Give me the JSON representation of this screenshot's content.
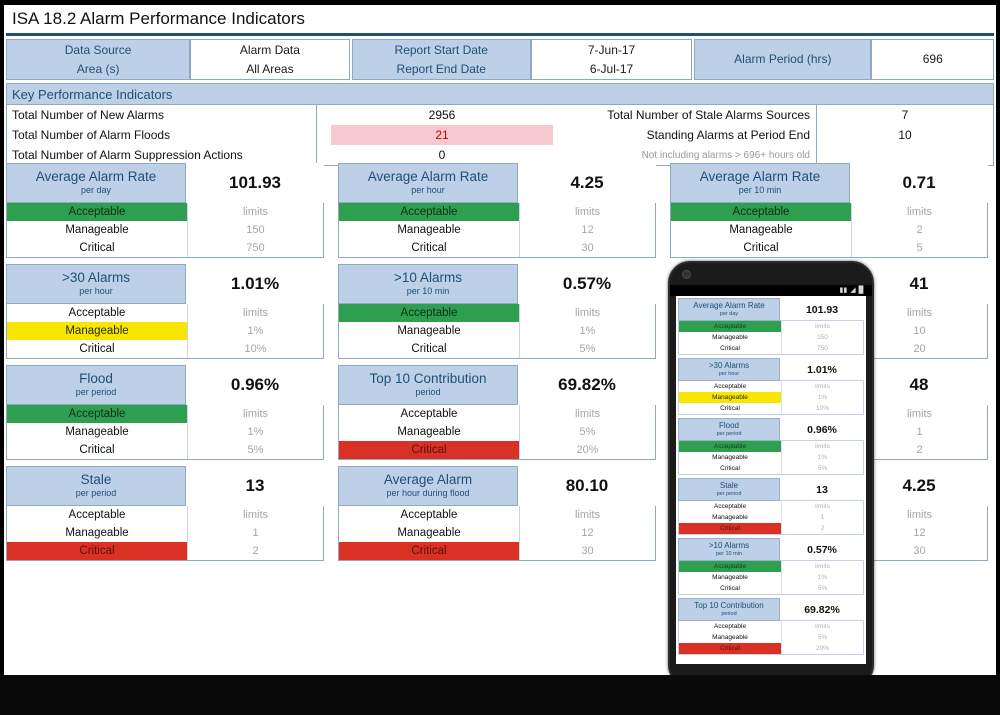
{
  "window": {
    "title": "ISA 18.2 Alarm Performance Indicators"
  },
  "source_bar": {
    "cells": [
      {
        "label_top": "Data Source",
        "label_bottom": "Area (s)",
        "value_top": "Alarm Data",
        "value_bottom": "All Areas"
      },
      {
        "label_top": "Report Start Date",
        "label_bottom": "Report End Date",
        "value_top": "7-Jun-17",
        "value_bottom": "6-Jul-17"
      },
      {
        "label_top": "Alarm Period (hrs)",
        "label_bottom": "",
        "value_top": "696",
        "value_bottom": ""
      }
    ]
  },
  "kpi": {
    "band_title": "Key Performance Indicators",
    "left_rows": [
      "Total Number of New Alarms",
      "Total Number of Alarm Floods",
      "Total Number of Alarm Suppression Actions"
    ],
    "mid_values": [
      "2956",
      "21",
      "0"
    ],
    "right_rows": [
      "Total Number of Stale Alarms Sources",
      "Standing Alarms at Period End",
      "Not including alarms > 696+ hours old"
    ],
    "right_values": [
      "7",
      "10",
      ""
    ]
  },
  "cards": [
    [
      {
        "title": "Average Alarm Rate",
        "subtitle": "per day",
        "value": "101.93",
        "levels": [
          "Acceptable",
          "Manageable",
          "Critical"
        ],
        "limits": [
          "limits",
          "150",
          "750"
        ],
        "status": "green"
      },
      {
        "title": "Average Alarm Rate",
        "subtitle": "per hour",
        "value": "4.25",
        "levels": [
          "Acceptable",
          "Manageable",
          "Critical"
        ],
        "limits": [
          "limits",
          "12",
          "30"
        ],
        "status": "green"
      },
      {
        "title": "Average Alarm Rate",
        "subtitle": "per 10 min",
        "value": "0.71",
        "levels": [
          "Acceptable",
          "Manageable",
          "Critical"
        ],
        "limits": [
          "limits",
          "2",
          "5"
        ],
        "status": "green"
      }
    ],
    [
      {
        "title": ">30 Alarms",
        "subtitle": "per hour",
        "value": "1.01%",
        "levels": [
          "Acceptable",
          "Manageable",
          "Critical"
        ],
        "limits": [
          "limits",
          "1%",
          "10%"
        ],
        "status": "yellow"
      },
      {
        "title": ">10 Alarms",
        "subtitle": "per 10 min",
        "value": "0.57%",
        "levels": [
          "Acceptable",
          "Manageable",
          "Critical"
        ],
        "limits": [
          "limits",
          "1%",
          "5%"
        ],
        "status": "green"
      },
      {
        "title": "",
        "subtitle": "",
        "value": "41",
        "levels": [
          "",
          "",
          ""
        ],
        "limits": [
          "limits",
          "10",
          "20"
        ],
        "status": "none",
        "obscured": true
      }
    ],
    [
      {
        "title": "Flood",
        "subtitle": "per period",
        "value": "0.96%",
        "levels": [
          "Acceptable",
          "Manageable",
          "Critical"
        ],
        "limits": [
          "limits",
          "1%",
          "5%"
        ],
        "status": "green"
      },
      {
        "title": "Top 10 Contribution",
        "subtitle": "period",
        "value": "69.82%",
        "levels": [
          "Acceptable",
          "Manageable",
          "Critical"
        ],
        "limits": [
          "limits",
          "5%",
          "20%"
        ],
        "status": "red"
      },
      {
        "title": "",
        "subtitle": "",
        "value": "48",
        "levels": [
          "",
          "",
          ""
        ],
        "limits": [
          "limits",
          "1",
          "2"
        ],
        "status": "none",
        "obscured": true
      }
    ],
    [
      {
        "title": "Stale",
        "subtitle": "per period",
        "value": "13",
        "levels": [
          "Acceptable",
          "Manageable",
          "Critical"
        ],
        "limits": [
          "limits",
          "1",
          "2"
        ],
        "status": "red"
      },
      {
        "title": "Average Alarm",
        "subtitle": "per hour during flood",
        "value": "80.10",
        "levels": [
          "Acceptable",
          "Manageable",
          "Critical"
        ],
        "limits": [
          "limits",
          "12",
          "30"
        ],
        "status": "red"
      },
      {
        "title": "",
        "subtitle": "",
        "value": "4.25",
        "levels": [
          "",
          "",
          ""
        ],
        "limits": [
          "limits",
          "12",
          "30"
        ],
        "status": "none",
        "obscured": true
      }
    ]
  ],
  "phone": {
    "status_icons": [
      "signal-icon",
      "wifi-icon",
      "battery-icon"
    ],
    "cards": [
      {
        "title": "Average Alarm Rate",
        "subtitle": "per day",
        "value": "101.93",
        "levels": [
          "Acceptable",
          "Manageable",
          "Critical"
        ],
        "limits": [
          "limits",
          "150",
          "750"
        ],
        "status": "green"
      },
      {
        "title": ">30 Alarms",
        "subtitle": "per hour",
        "value": "1.01%",
        "levels": [
          "Acceptable",
          "Manageable",
          "Critical"
        ],
        "limits": [
          "limits",
          "1%",
          "10%"
        ],
        "status": "yellow"
      },
      {
        "title": "Flood",
        "subtitle": "per period",
        "value": "0.96%",
        "levels": [
          "Acceptable",
          "Manageable",
          "Critical"
        ],
        "limits": [
          "limits",
          "1%",
          "5%"
        ],
        "status": "green"
      },
      {
        "title": "Stale",
        "subtitle": "per period",
        "value": "13",
        "levels": [
          "Acceptable",
          "Manageable",
          "Critical"
        ],
        "limits": [
          "limits",
          "1",
          "2"
        ],
        "status": "red"
      },
      {
        "title": ">10 Alarms",
        "subtitle": "per 10 min",
        "value": "0.57%",
        "levels": [
          "Acceptable",
          "Manageable",
          "Critical"
        ],
        "limits": [
          "limits",
          "1%",
          "5%"
        ],
        "status": "green"
      },
      {
        "title": "Top 10 Contribution",
        "subtitle": "period",
        "value": "69.82%",
        "levels": [
          "Acceptable",
          "Manageable",
          "Critical"
        ],
        "limits": [
          "limits",
          "5%",
          "20%"
        ],
        "status": "red"
      }
    ]
  },
  "colors": {
    "header_blue": "#bdd0e7",
    "header_text": "#1f4e79",
    "acceptable_green": "#2e9e4f",
    "manageable_yellow": "#f7e600",
    "critical_red": "#d93224",
    "flood_pink": "#f5c9cf",
    "flood_text": "#c00000"
  }
}
